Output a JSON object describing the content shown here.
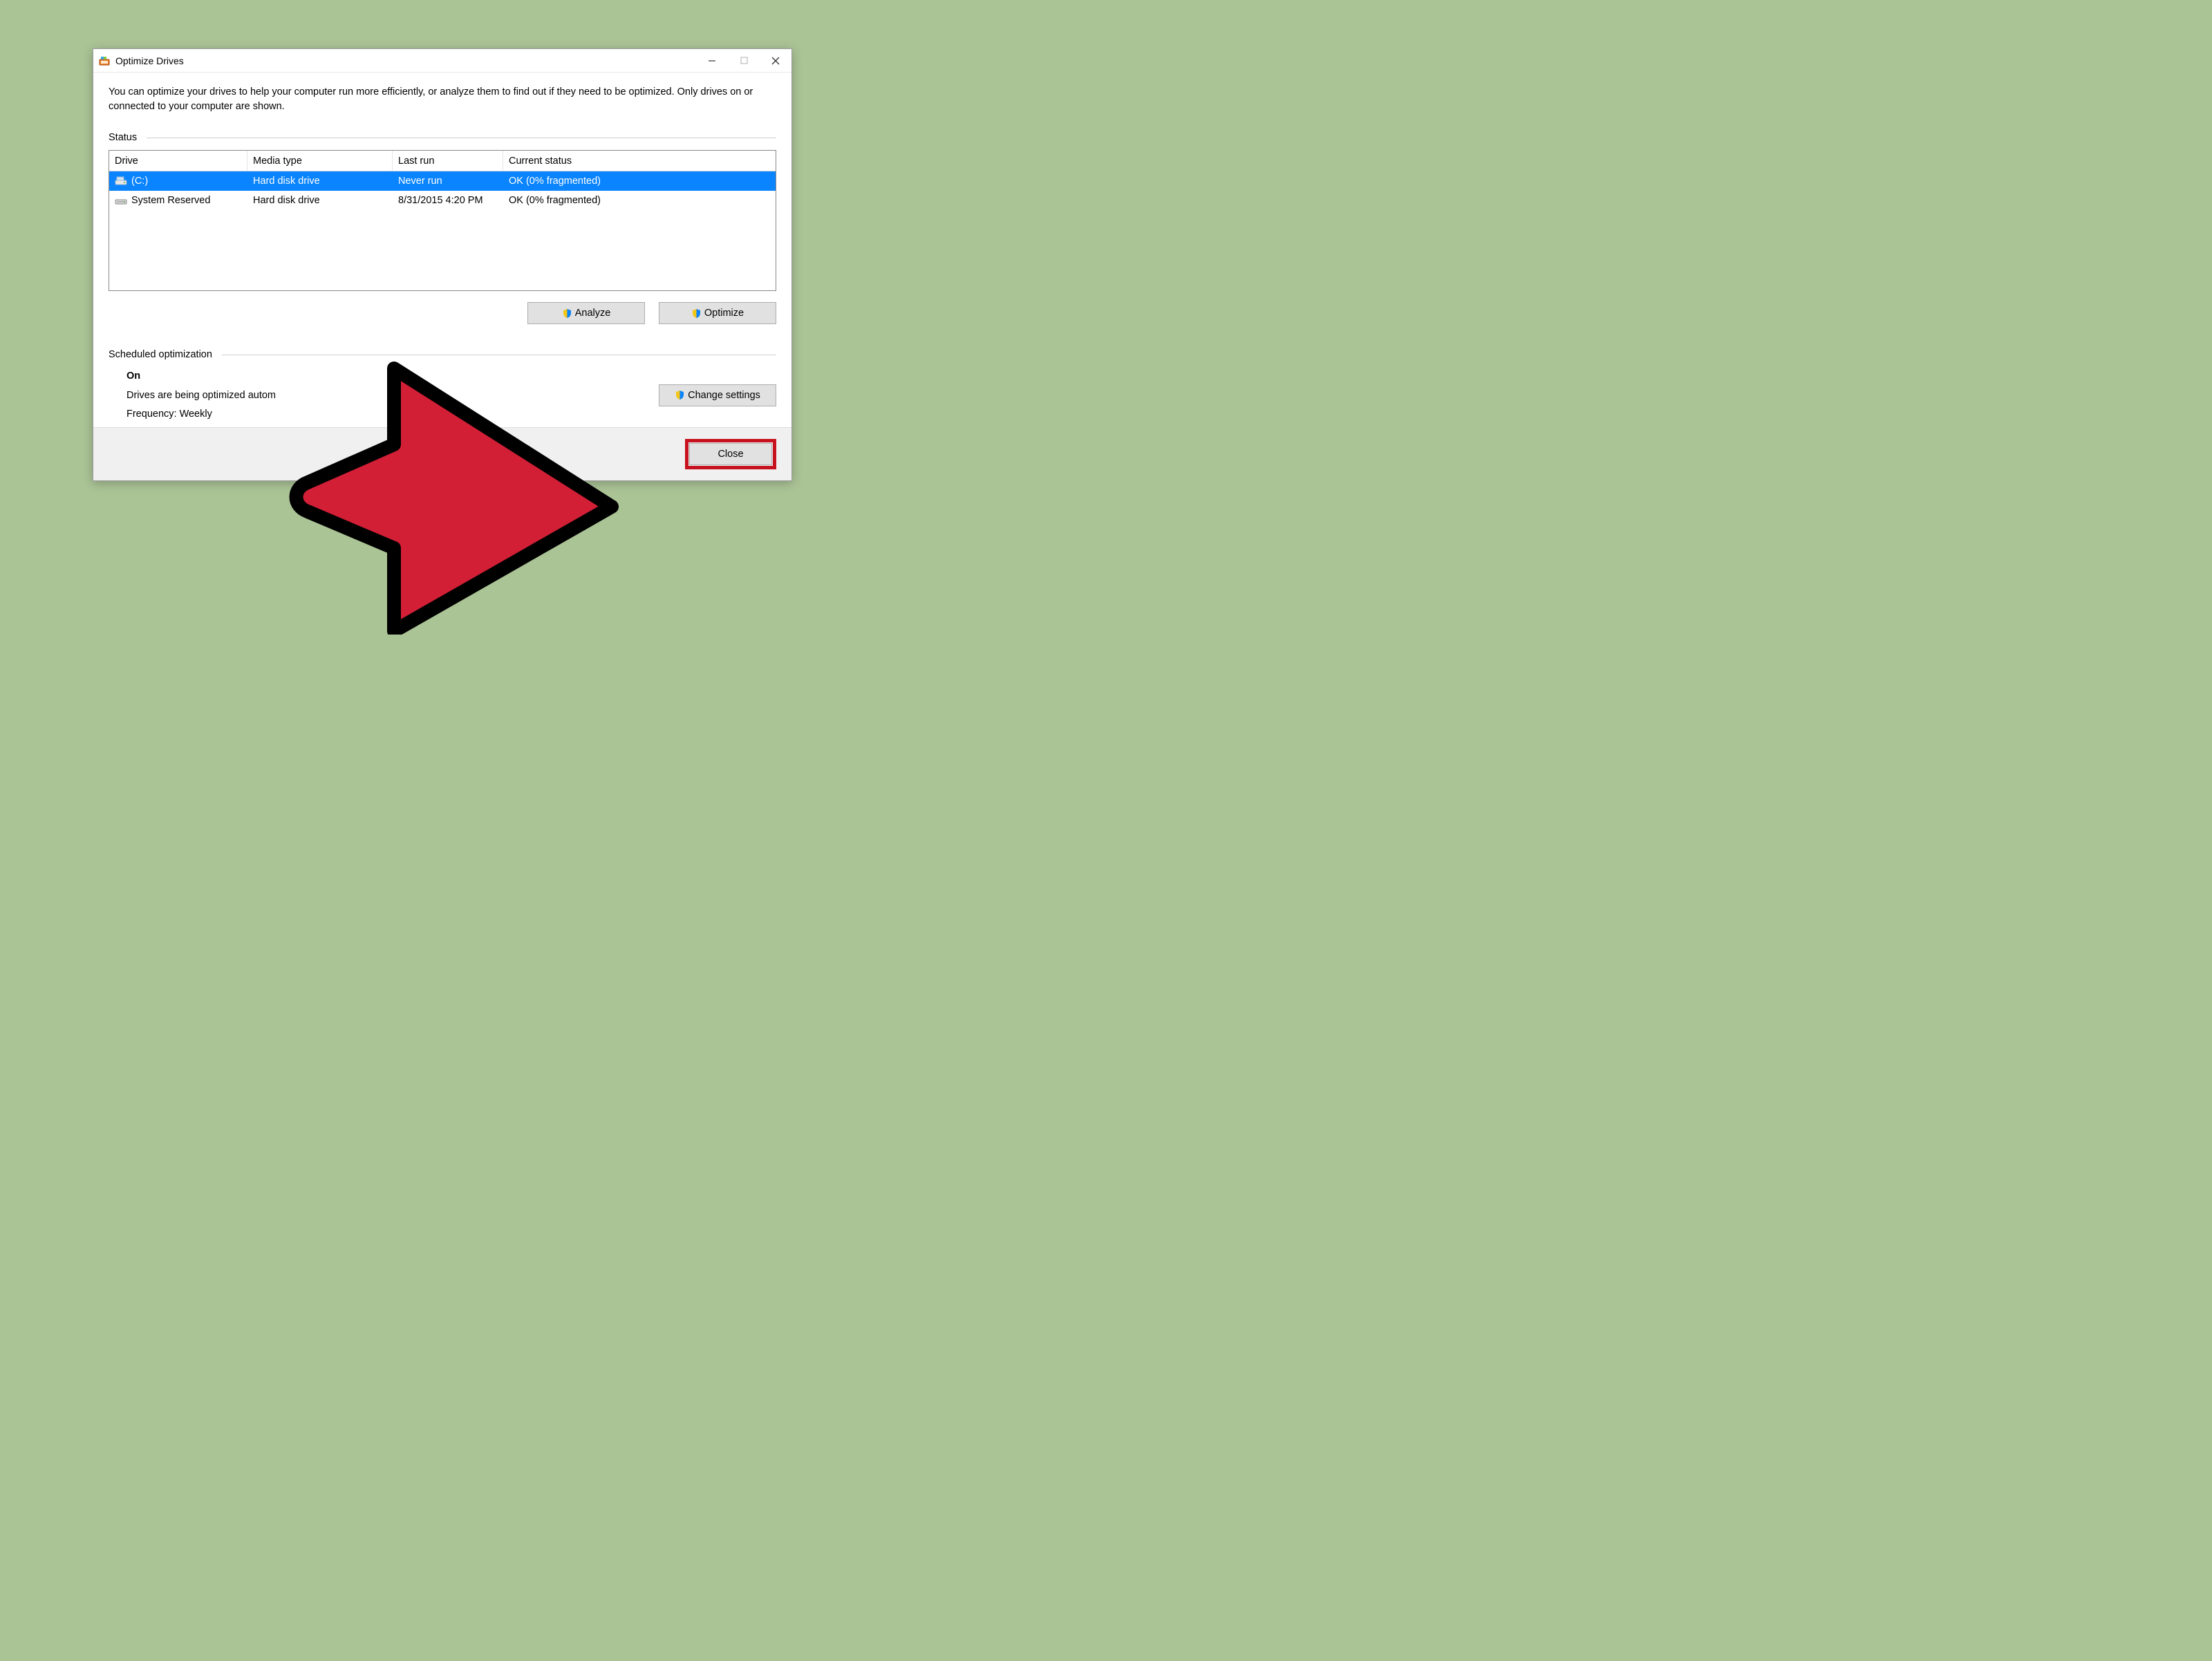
{
  "window": {
    "title": "Optimize Drives",
    "description": "You can optimize your drives to help your computer run more efficiently, or analyze them to find out if they need to be optimized. Only drives on or connected to your computer are shown.",
    "status_label": "Status",
    "columns": {
      "drive": "Drive",
      "media": "Media type",
      "last": "Last run",
      "status": "Current status"
    },
    "drives": [
      {
        "name": "(C:)",
        "media": "Hard disk drive",
        "last": "Never run",
        "status": "OK (0% fragmented)",
        "selected": true
      },
      {
        "name": "System Reserved",
        "media": "Hard disk drive",
        "last": "8/31/2015 4:20 PM",
        "status": "OK (0% fragmented)",
        "selected": false
      }
    ],
    "buttons": {
      "analyze": "Analyze",
      "optimize": "Optimize",
      "change_settings": "Change settings",
      "close": "Close"
    },
    "scheduled": {
      "label": "Scheduled optimization",
      "state": "On",
      "info": "Drives are being optimized autom",
      "frequency": "Frequency: Weekly"
    }
  },
  "annotation": {
    "arrow_color": "#d21f36",
    "arrow_stroke": "#000000"
  }
}
